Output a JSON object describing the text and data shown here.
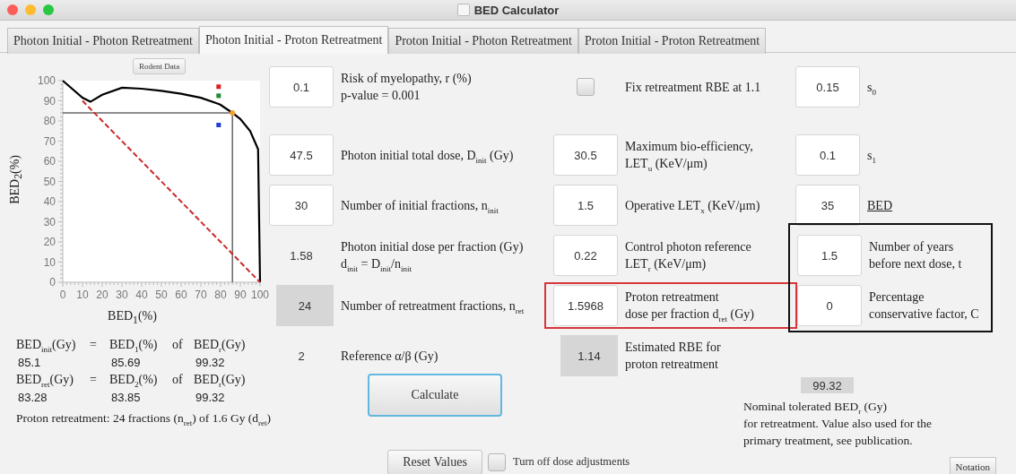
{
  "window": {
    "title": "BED Calculator"
  },
  "tabs": [
    {
      "label": "Photon Initial - Photon Retreatment",
      "selected": false
    },
    {
      "label": "Photon Initial - Proton Retreatment",
      "selected": true
    },
    {
      "label": "Proton Initial - Photon Retreatment",
      "selected": false
    },
    {
      "label": "Proton Initial - Proton Retreatment",
      "selected": false
    }
  ],
  "rodent_button": "Rodent Data",
  "chart": {
    "chart_data": {
      "type": "line",
      "xlabel": "BED$_{1}$(%)",
      "ylabel": "BED$_{2}$(%)",
      "x": [
        0,
        10,
        14,
        20,
        30,
        40,
        50,
        60,
        70,
        79,
        80,
        86,
        90,
        95,
        99,
        100
      ],
      "series": [
        {
          "color": "#000000",
          "line_style": "solid",
          "values": [
            100,
            91.5,
            89.5,
            93,
            96.5,
            96,
            95,
            93.5,
            91.5,
            88.5,
            88,
            84,
            81,
            75,
            66,
            0
          ]
        },
        {
          "color": "#cc2a2a",
          "line_style": "dashed",
          "values": [
            null,
            90,
            86,
            80,
            70,
            60,
            50,
            40,
            30,
            21,
            20,
            14,
            10,
            5,
            1,
            0
          ]
        },
        {
          "color": "#dd1f1f",
          "line_style": "none",
          "marker": "square",
          "values": [
            null,
            null,
            null,
            null,
            null,
            null,
            null,
            null,
            null,
            97,
            null,
            null,
            null,
            null,
            null,
            null
          ]
        },
        {
          "color": "#1e8a32",
          "line_style": "none",
          "marker": "square",
          "values": [
            null,
            null,
            null,
            null,
            null,
            null,
            null,
            null,
            null,
            92.5,
            null,
            null,
            null,
            null,
            null,
            null
          ]
        },
        {
          "color": "#1f3fd6",
          "line_style": "none",
          "marker": "square",
          "values": [
            null,
            null,
            null,
            null,
            null,
            null,
            null,
            null,
            null,
            78,
            null,
            null,
            null,
            null,
            null,
            null
          ]
        }
      ],
      "ref_lines": [
        {
          "axis": "y",
          "value": 84
        },
        {
          "axis": "x",
          "value": 86
        }
      ],
      "xlim": [
        0,
        100
      ],
      "ylim": [
        0,
        100
      ],
      "xticks": [
        0,
        10,
        20,
        30,
        40,
        50,
        60,
        70,
        80,
        90,
        100
      ],
      "yticks": [
        0,
        10,
        20,
        30,
        40,
        50,
        60,
        70,
        80,
        90,
        100
      ]
    }
  },
  "results": [
    {
      "terms": [
        "BED$_{init}$(Gy)",
        "=",
        "BED$_{1}$(%)",
        "of",
        "BED$_{r}$(Gy)"
      ],
      "values": [
        "85.1",
        "85.69",
        "99.32"
      ]
    },
    {
      "terms": [
        "BED$_{ret}$(Gy)",
        "=",
        "BED$_{2}$(%)",
        "of",
        "BED$_{r}$(Gy)"
      ],
      "values": [
        "83.28",
        "83.85",
        "99.32"
      ]
    }
  ],
  "summary": "Proton retreatment:  24 fractions (n$_{ret}$) of 1.6 Gy (d$_{ret}$)",
  "columns": [
    {
      "rows": [
        {
          "kind": "input",
          "value": "0.1",
          "lines": [
            "Risk of myelopathy, r (%)",
            "p-value = 0.001"
          ],
          "highlighted": false
        },
        {
          "kind": "input",
          "value": "47.5",
          "lines": [
            "Photon initial total dose, D$_{init}$ (Gy)"
          ],
          "highlighted": false
        },
        {
          "kind": "input",
          "value": "30",
          "lines": [
            "Number of initial fractions, n$_{init}$"
          ],
          "highlighted": false
        },
        {
          "kind": "plain",
          "value": "1.58",
          "lines": [
            "Photon initial dose per fraction (Gy)",
            "d$_{init}$ = D$_{init}$/n$_{init}$"
          ],
          "highlighted": false
        },
        {
          "kind": "readonly",
          "value": "24",
          "lines": [
            "Number of retreatment fractions, n$_{ret}$"
          ],
          "highlighted": false
        },
        {
          "kind": "plain",
          "value": "2",
          "lines": [
            "Reference α/β (Gy)"
          ],
          "highlighted": false
        }
      ]
    },
    {
      "rows": [
        {
          "kind": "checkbox",
          "checked": false,
          "lines": [
            "Fix retreatment RBE at 1.1"
          ],
          "highlighted": false
        },
        {
          "kind": "input",
          "value": "30.5",
          "lines": [
            "Maximum bio-efficiency,",
            "LET$_{u}$ (KeV/μm)"
          ],
          "highlighted": false
        },
        {
          "kind": "input",
          "value": "1.5",
          "lines": [
            "Operative LET$_{x}$ (KeV/μm)"
          ],
          "highlighted": false
        },
        {
          "kind": "input",
          "value": "0.22",
          "lines": [
            "Control photon reference",
            "LET$_{r}$ (KeV/μm)"
          ],
          "highlighted": false
        },
        {
          "kind": "input",
          "value": "1.5968",
          "lines": [
            "Proton retreatment",
            "dose per fraction d$_{ret}$ (Gy)"
          ],
          "highlighted": true
        },
        {
          "kind": "readonly",
          "value": "1.14",
          "lines": [
            "Estimated RBE for",
            "proton retreatment"
          ],
          "highlighted": false
        }
      ]
    },
    {
      "rows": [
        {
          "kind": "input",
          "value": "0.15",
          "lines": [
            "s$_{0}$"
          ],
          "highlighted": false,
          "underlined": false
        },
        {
          "kind": "input",
          "value": "0.1",
          "lines": [
            "s$_{1}$"
          ],
          "highlighted": false,
          "underlined": false
        },
        {
          "kind": "input",
          "value": "35",
          "lines": [
            "BED"
          ],
          "highlighted": false,
          "underlined": true
        }
      ],
      "group": [
        {
          "kind": "input",
          "value": "1.5",
          "lines": [
            "Number of years",
            "before next dose, t"
          ],
          "highlighted": false
        },
        {
          "kind": "input",
          "value": "0",
          "lines": [
            "Percentage",
            "conservative factor, C"
          ],
          "highlighted": false
        }
      ]
    }
  ],
  "calculate_button": "Calculate",
  "nominal": {
    "value": "99.32",
    "lines": [
      "Nominal tolerated BED$_{r}$ (Gy)",
      "for retreatment. Value also used for the",
      "primary treatment, see publication."
    ]
  },
  "reset_button": "Reset Values",
  "dose_toggle": {
    "label": "Turn off dose adjustments",
    "checked": false
  },
  "notation_button": "Notation"
}
